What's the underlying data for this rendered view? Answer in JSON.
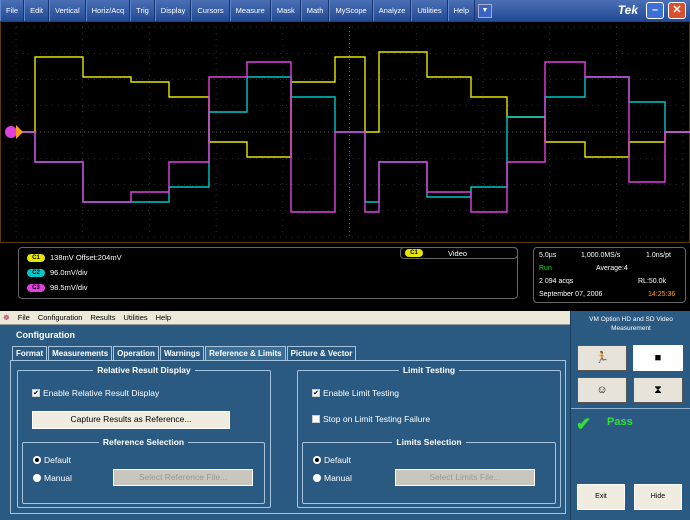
{
  "menubar": {
    "items": [
      "File",
      "Edit",
      "Vertical",
      "Horiz/Acq",
      "Trig",
      "Display",
      "Cursors",
      "Measure",
      "Mask",
      "Math",
      "MyScope",
      "Analyze",
      "Utilities",
      "Help"
    ],
    "dropdown_icon": "triangle-down-icon",
    "brand": "Tek",
    "minimize_icon": "minimize-icon",
    "close_icon": "close-icon"
  },
  "channels": {
    "c1_tag": "C1",
    "c1_text": "138mV  Offset:204mV",
    "c2_tag": "C2",
    "c2_text": "96.0mV/div",
    "c3_tag": "C3",
    "c3_text": "98.5mV/div",
    "colors": {
      "c1": "#e6e600",
      "c2": "#00c8c8",
      "c3": "#e040e0"
    }
  },
  "trigger": {
    "tag": "C1",
    "label": "Video"
  },
  "acquisition": {
    "timebase": "5.0µs",
    "sample_rate": "1,000.0MS/s",
    "resolution": "1.0ns/pt",
    "state": "Run",
    "mode": "Average:4",
    "acqs": "2 094 acqs",
    "record_length": "RL:50.0k",
    "date": "September 07, 2006",
    "time": "14:25:36"
  },
  "app": {
    "menu": [
      "File",
      "Configuration",
      "Results",
      "Utilities",
      "Help"
    ],
    "title": "Configuration",
    "tabs": [
      "Format",
      "Measurements",
      "Operation",
      "Warnings",
      "Reference & Limits",
      "Picture & Vector"
    ],
    "active_tab": "Reference & Limits",
    "relative_group": {
      "title": "Relative Result Display",
      "enable_label": "Enable Relative Result Display",
      "enable_checked": true,
      "capture_button": "Capture Results as Reference..."
    },
    "reference_selection": {
      "title": "Reference Selection",
      "default_label": "Default",
      "manual_label": "Manual",
      "selected": "Default",
      "select_button": "Select Reference File..."
    },
    "limit_group": {
      "title": "Limit Testing",
      "enable_label": "Enable Limit Testing",
      "enable_checked": true,
      "stop_label": "Stop on Limit Testing Failure",
      "stop_checked": false
    },
    "limits_selection": {
      "title": "Limits Selection",
      "default_label": "Default",
      "manual_label": "Manual",
      "selected": "Default",
      "select_button": "Select Limits File..."
    }
  },
  "side_panel": {
    "header": "VM Option HD and SD Video Measurement",
    "run_icon": "running-man-icon",
    "stop_icon": "stop-square-icon",
    "face_icon": "face-icon",
    "hourglass_icon": "hourglass-icon",
    "status": "Pass",
    "status_icon": "checkmark-icon",
    "exit_label": "Exit",
    "hide_label": "Hide"
  }
}
